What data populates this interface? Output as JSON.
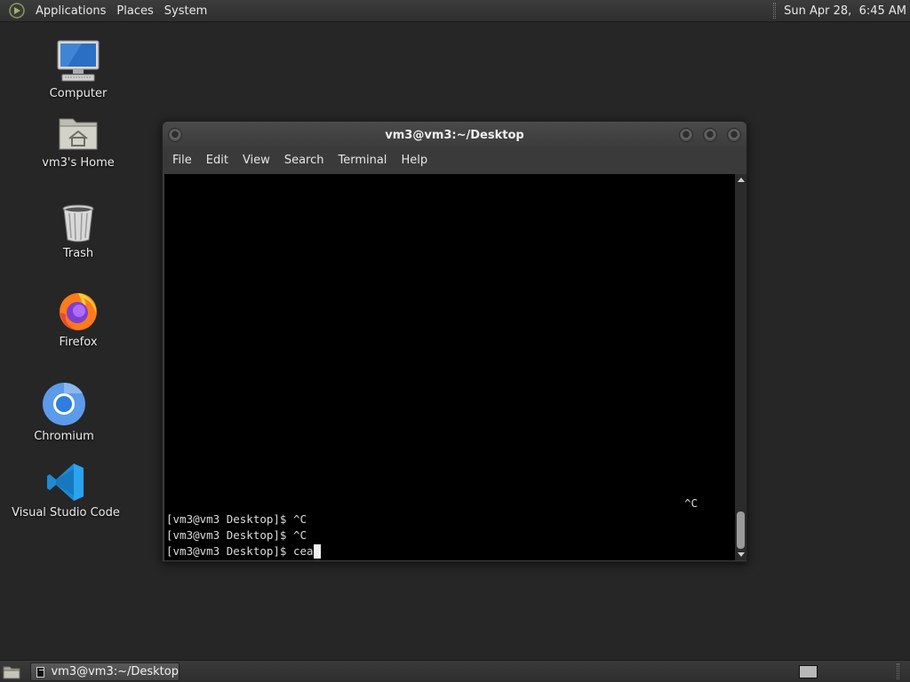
{
  "top_panel": {
    "menus": [
      "Applications",
      "Places",
      "System"
    ],
    "clock": "Sun Apr 28,  6:45 AM"
  },
  "desktop": {
    "icons": [
      {
        "label": "Computer",
        "icon": "computer-icon"
      },
      {
        "label": "vm3's Home",
        "icon": "home-folder-icon"
      },
      {
        "label": "Trash",
        "icon": "trash-icon"
      },
      {
        "label": "Firefox",
        "icon": "firefox-icon"
      },
      {
        "label": "Chromium",
        "icon": "chromium-icon"
      },
      {
        "label": "Visual Studio Code",
        "icon": "vscode-icon"
      }
    ]
  },
  "terminal": {
    "title": "vm3@vm3:~/Desktop",
    "menu": [
      "File",
      "Edit",
      "View",
      "Search",
      "Terminal",
      "Help"
    ],
    "stray_output": "^C",
    "lines": [
      "[vm3@vm3 Desktop]$ ^C",
      "[vm3@vm3 Desktop]$ ^C",
      "[vm3@vm3 Desktop]$ cea"
    ]
  },
  "taskbar": {
    "window_button": "vm3@vm3:~/Desktop"
  },
  "colors": {
    "desktop_bg": "#262626",
    "panel_bg": "#333333",
    "terminal_bg": "#000000",
    "terminal_fg": "#dcdcdc"
  }
}
